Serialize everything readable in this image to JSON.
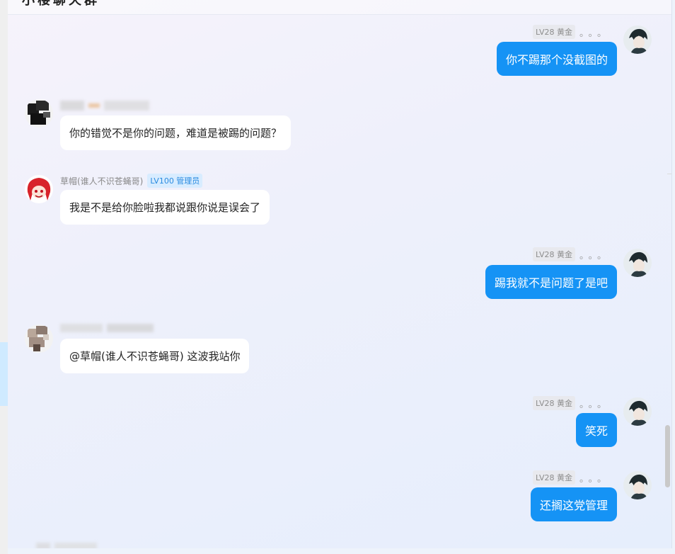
{
  "header": {
    "title": "小楼聊天群"
  },
  "messages": [
    {
      "side": "right",
      "level": "LV28 黄金",
      "dots": "。。。",
      "text": "你不踢那个没截图的"
    },
    {
      "side": "left",
      "name": "",
      "level": "",
      "text": "你的错觉不是你的问题，难道是被踢的问题？"
    },
    {
      "side": "left",
      "name": "草帽(谁人不识苍蝇哥)",
      "level": "LV100 管理员",
      "text": "我是不是给你脸啦我都说跟你说是误会了"
    },
    {
      "side": "right",
      "level": "LV28 黄金",
      "dots": "。。。",
      "text": "踢我就不是问题了是吧"
    },
    {
      "side": "left",
      "name": "",
      "level": "",
      "text": "@草帽(谁人不识苍蝇哥) 这波我站你"
    },
    {
      "side": "right",
      "level": "LV28 黄金",
      "dots": "。。。",
      "text": "笑死"
    },
    {
      "side": "right",
      "level": "LV28 黄金",
      "dots": "。。。",
      "text": "还搁这党管理"
    }
  ]
}
